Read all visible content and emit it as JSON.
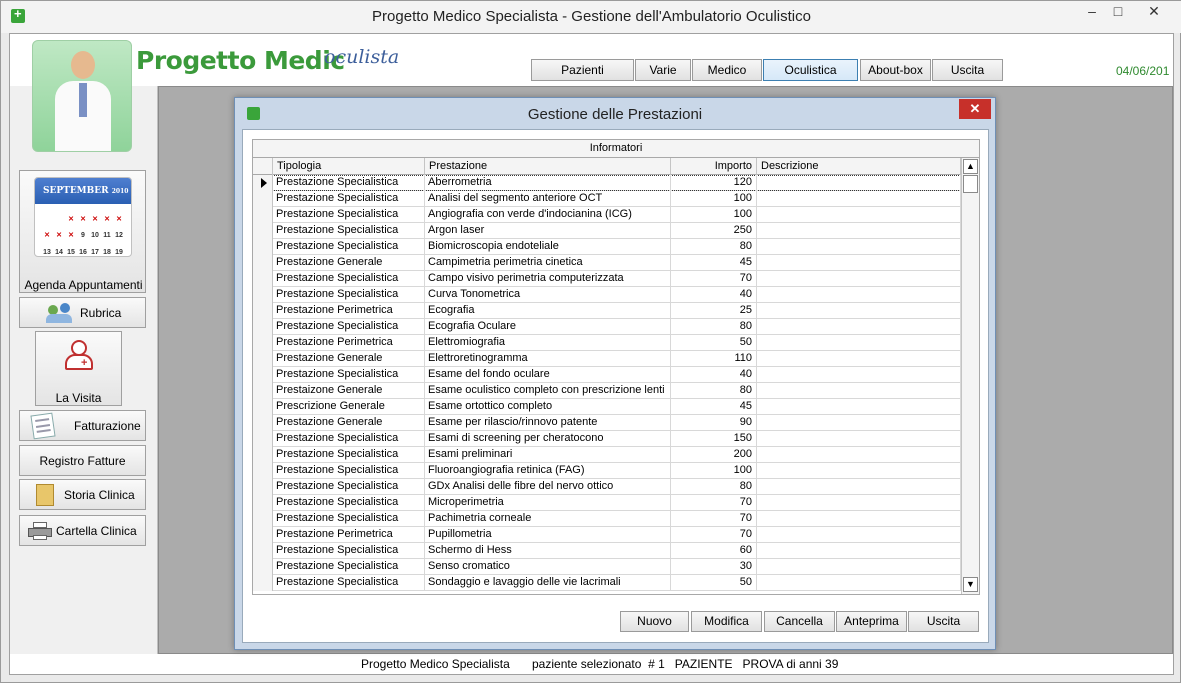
{
  "window": {
    "title": "Progetto Medico Specialista - Gestione dell'Ambulatorio Oculistico"
  },
  "header": {
    "logo_main": "Progetto Medic",
    "logo_sub": "oculista",
    "date": "04/06/201",
    "menu": [
      "Pazienti",
      "Varie",
      "Medico",
      "Oculistica",
      "About-box",
      "Uscita"
    ],
    "active_menu": "Oculistica"
  },
  "sidebar": {
    "calendar_month": "SEPTEMBER",
    "calendar_year": "2010",
    "agenda": "Agenda Appuntamenti",
    "rubrica": "Rubrica",
    "visita": "La Visita",
    "fatturazione": "Fatturazione",
    "registro": "Registro Fatture",
    "storia": "Storia Clinica",
    "cartella": "Cartella Clinica"
  },
  "dialog": {
    "title": "Gestione delle Prestazioni",
    "close": "✕",
    "caption": "Informatori",
    "columns": [
      "Tipologia",
      "Prestazione",
      "Importo",
      "Descrizione"
    ],
    "rows": [
      [
        "Prestazione Specialistica",
        "Aberrometria",
        "120",
        ""
      ],
      [
        "Prestazione Specialistica",
        "Analisi del segmento anteriore OCT",
        "100",
        ""
      ],
      [
        "Prestazione Specialistica",
        "Angiografia con verde d'indocianina (ICG)",
        "100",
        ""
      ],
      [
        "Prestazione Specialistica",
        "Argon laser",
        "250",
        ""
      ],
      [
        "Prestazione Specialistica",
        "Biomicroscopia endoteliale",
        "80",
        ""
      ],
      [
        "Prestazione Generale",
        "Campimetria perimetria cinetica",
        "45",
        ""
      ],
      [
        "Prestazione Specialistica",
        "Campo visivo perimetria computerizzata",
        "70",
        ""
      ],
      [
        "Prestazione Specialistica",
        "Curva Tonometrica",
        "40",
        ""
      ],
      [
        "Prestazione Perimetrica",
        "Ecografia",
        "25",
        ""
      ],
      [
        "Prestazione Specialistica",
        "Ecografia Oculare",
        "80",
        ""
      ],
      [
        "Prestazione Perimetrica",
        "Elettromiografia",
        "50",
        ""
      ],
      [
        "Prestazione Generale",
        "Elettroretinogramma",
        "110",
        ""
      ],
      [
        "Prestazione Specialistica",
        "Esame del fondo oculare",
        "40",
        ""
      ],
      [
        "Prestaizone Generale",
        "Esame oculistico completo con prescrizione lenti",
        "80",
        ""
      ],
      [
        "Prescrizione Generale",
        "Esame ortottico completo",
        "45",
        ""
      ],
      [
        "Prestazione Generale",
        "Esame per rilascio/rinnovo patente",
        "90",
        ""
      ],
      [
        "Prestazione Specialistica",
        "Esami di screening per cheratocono",
        "150",
        ""
      ],
      [
        "Prestazione Specialistica",
        "Esami preliminari",
        "200",
        ""
      ],
      [
        "Prestazione Specialistica",
        "Fluoroangiografia retinica (FAG)",
        "100",
        ""
      ],
      [
        "Prestazione Specialistica",
        "GDx Analisi delle fibre del nervo ottico",
        "80",
        ""
      ],
      [
        "Prestazione Specialistica",
        "Microperimetria",
        "70",
        ""
      ],
      [
        "Prestazione Specialistica",
        "Pachimetria corneale",
        "70",
        ""
      ],
      [
        "Prestazione Perimetrica",
        "Pupillometria",
        "70",
        ""
      ],
      [
        "Prestazione Specialistica",
        "Schermo di Hess",
        "60",
        ""
      ],
      [
        "Prestazione Specialistica",
        "Senso cromatico",
        "30",
        ""
      ],
      [
        "Prestazione Specialistica",
        "Sondaggio e lavaggio delle vie lacrimali",
        "50",
        ""
      ]
    ],
    "buttons": [
      "Nuovo",
      "Modifica",
      "Cancella",
      "Anteprima",
      "Uscita"
    ]
  },
  "status": {
    "app": "Progetto Medico Specialista",
    "patient": "paziente selezionato  # 1   PAZIENTE   PROVA di anni 39"
  }
}
